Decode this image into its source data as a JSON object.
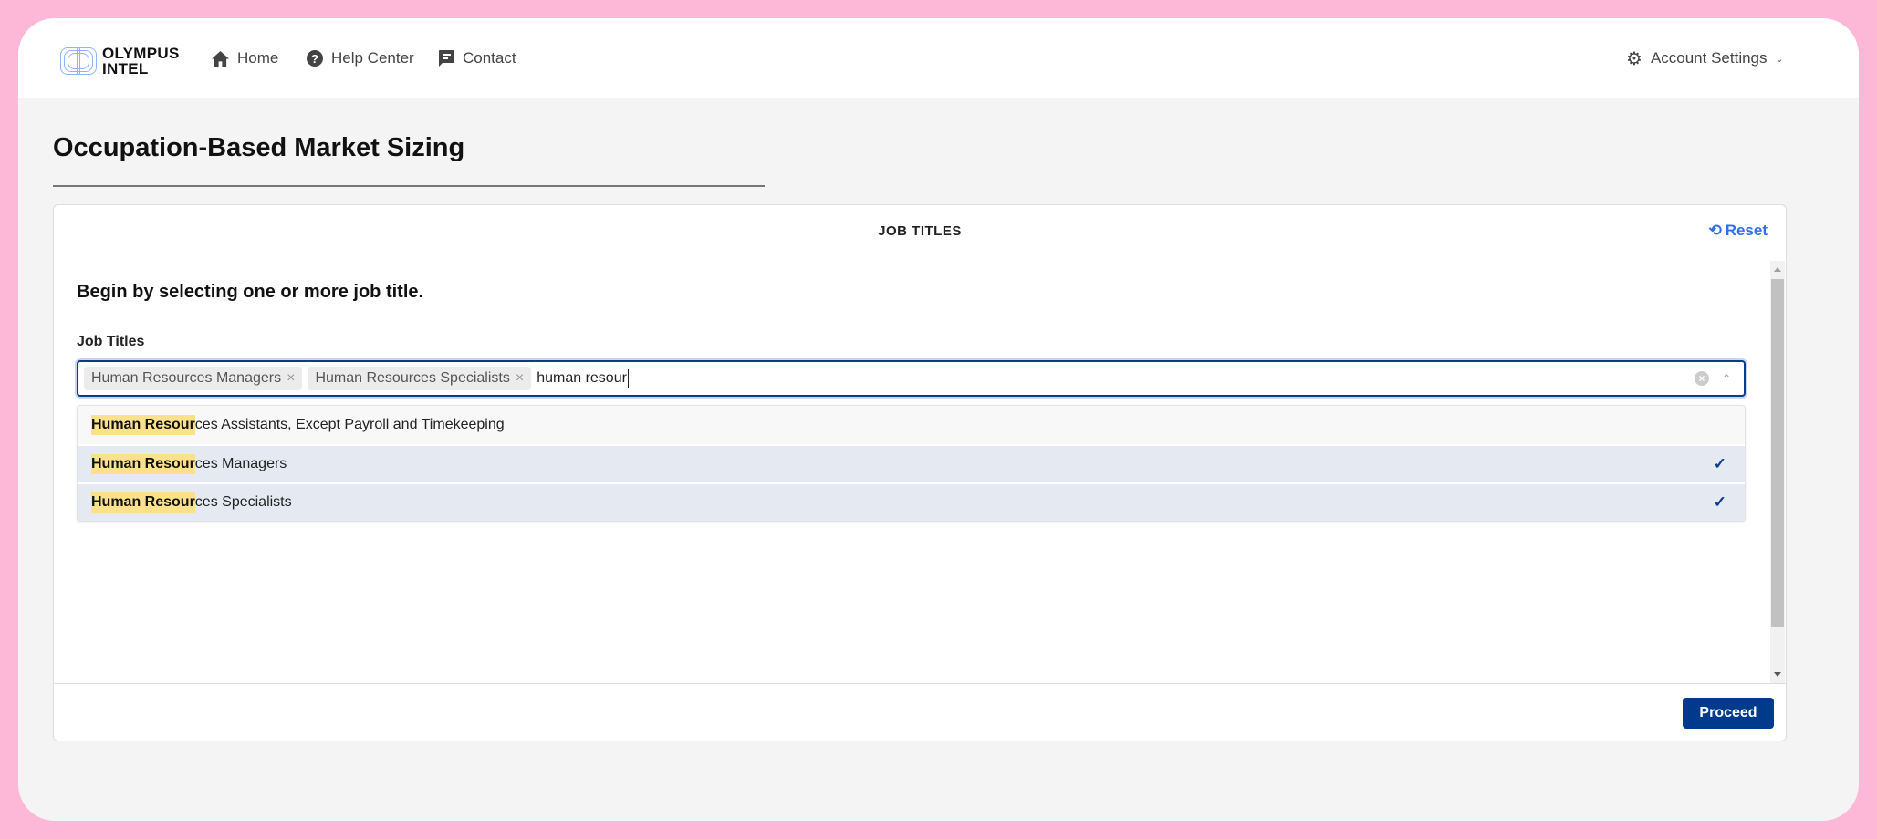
{
  "header": {
    "logo": {
      "line1": "OLYMPUS",
      "line2": "INTEL"
    },
    "nav": [
      {
        "label": "Home",
        "icon": "home-icon"
      },
      {
        "label": "Help Center",
        "icon": "question-circle-icon"
      },
      {
        "label": "Contact",
        "icon": "message-icon"
      }
    ],
    "account": {
      "label": "Account Settings",
      "icon": "gear-icon"
    }
  },
  "page": {
    "title": "Occupation-Based Market Sizing"
  },
  "card": {
    "title": "JOB TITLES",
    "reset_label": "Reset",
    "lead": "Begin by selecting one or more job title.",
    "field_label": "Job Titles",
    "chips": [
      "Human Resources Managers",
      "Human Resources Specialists"
    ],
    "typed_value": "human resour",
    "options": [
      {
        "match": "Human Resour",
        "rest": "ces Assistants, Except Payroll and Timekeeping",
        "selected": false
      },
      {
        "match": "Human Resour",
        "rest": "ces Managers",
        "selected": true
      },
      {
        "match": "Human Resour",
        "rest": "ces Specialists",
        "selected": true
      }
    ],
    "proceed_label": "Proceed"
  },
  "colors": {
    "frame": "#fdb8d8",
    "primary": "#003a8c",
    "link": "#2f6fe8",
    "highlight": "#fde18a",
    "selected_row": "#e4e9f2"
  }
}
